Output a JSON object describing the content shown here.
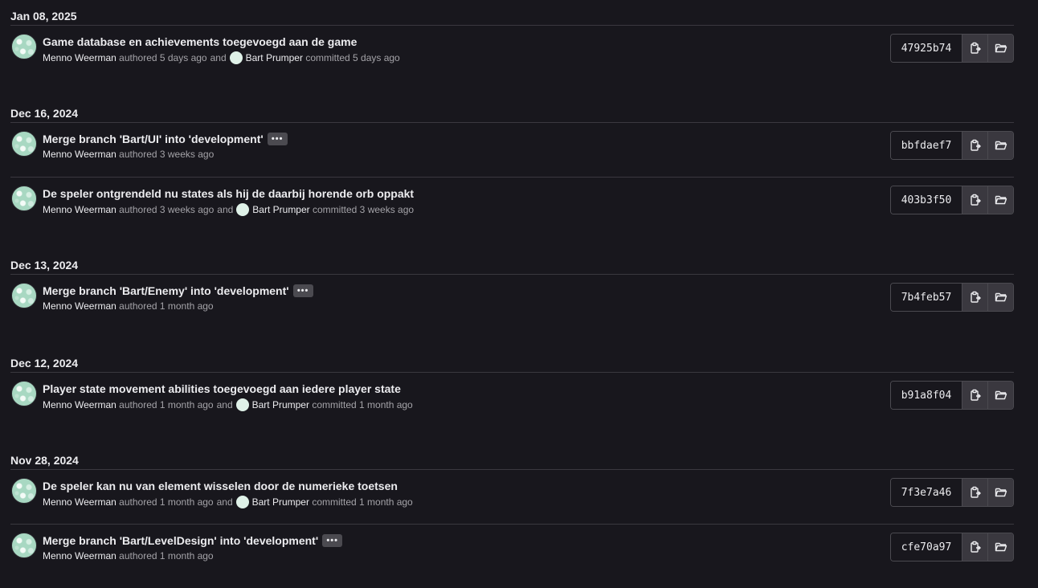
{
  "groups": [
    {
      "date": "Jan 08, 2025",
      "commits": [
        {
          "title": "Game database en achievements toegevoegd aan de game",
          "has_more": false,
          "author": "Menno Weerman",
          "authored": "authored 5 days ago",
          "and": "and",
          "committer": "Bart Prumper",
          "committed": "committed 5 days ago",
          "sha": "47925b74"
        }
      ]
    },
    {
      "date": "Dec 16, 2024",
      "commits": [
        {
          "title": "Merge branch 'Bart/UI' into 'development'",
          "has_more": true,
          "author": "Menno Weerman",
          "authored": "authored 3 weeks ago",
          "sha": "bbfdaef7"
        },
        {
          "title": "De speler ontgrendeld nu states als hij de daarbij horende orb oppakt",
          "has_more": false,
          "author": "Menno Weerman",
          "authored": "authored 3 weeks ago",
          "and": "and",
          "committer": "Bart Prumper",
          "committed": "committed 3 weeks ago",
          "sha": "403b3f50"
        }
      ]
    },
    {
      "date": "Dec 13, 2024",
      "commits": [
        {
          "title": "Merge branch 'Bart/Enemy' into 'development'",
          "has_more": true,
          "author": "Menno Weerman",
          "authored": "authored 1 month ago",
          "sha": "7b4feb57"
        }
      ]
    },
    {
      "date": "Dec 12, 2024",
      "commits": [
        {
          "title": "Player state movement abilities toegevoegd aan iedere player state",
          "has_more": false,
          "author": "Menno Weerman",
          "authored": "authored 1 month ago",
          "and": "and",
          "committer": "Bart Prumper",
          "committed": "committed 1 month ago",
          "sha": "b91a8f04"
        }
      ]
    },
    {
      "date": "Nov 28, 2024",
      "commits": [
        {
          "title": "De speler kan nu van element wisselen door de numerieke toetsen",
          "has_more": false,
          "author": "Menno Weerman",
          "authored": "authored 1 month ago",
          "and": "and",
          "committer": "Bart Prumper",
          "committed": "committed 1 month ago",
          "sha": "7f3e7a46"
        },
        {
          "title": "Merge branch 'Bart/LevelDesign' into 'development'",
          "has_more": true,
          "author": "Menno Weerman",
          "authored": "authored 1 month ago",
          "sha": "cfe70a97"
        }
      ]
    }
  ],
  "more_label": "•••",
  "icons": {
    "copy": "clipboard-icon",
    "browse": "folder-open-icon"
  }
}
